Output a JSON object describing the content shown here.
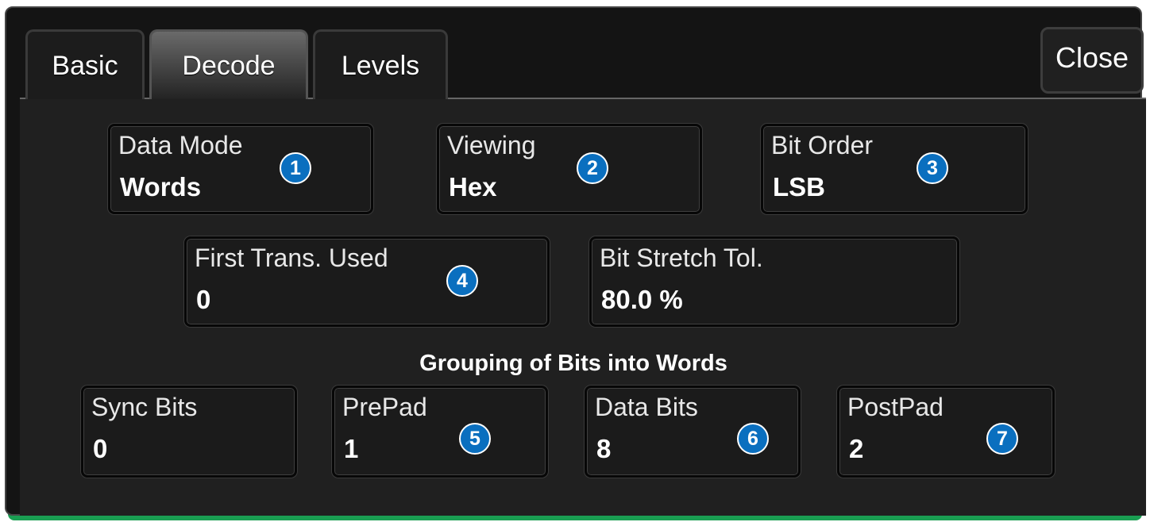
{
  "tabs": [
    {
      "label": "Basic",
      "active": false
    },
    {
      "label": "Decode",
      "active": true
    },
    {
      "label": "Levels",
      "active": false
    }
  ],
  "close_label": "Close",
  "fields": {
    "data_mode": {
      "label": "Data Mode",
      "value": "Words",
      "badge": "1"
    },
    "viewing": {
      "label": "Viewing",
      "value": "Hex",
      "badge": "2"
    },
    "bit_order": {
      "label": "Bit Order",
      "value": "LSB",
      "badge": "3"
    },
    "first_trans_used": {
      "label": "First Trans. Used",
      "value": "0",
      "badge": "4"
    },
    "bit_stretch_tol": {
      "label": "Bit Stretch Tol.",
      "value": "80.0 %"
    },
    "sync_bits": {
      "label": "Sync Bits",
      "value": "0"
    },
    "prepad": {
      "label": "PrePad",
      "value": "1",
      "badge": "5"
    },
    "data_bits": {
      "label": "Data Bits",
      "value": "8",
      "badge": "6"
    },
    "postpad": {
      "label": "PostPad",
      "value": "2",
      "badge": "7"
    }
  },
  "grouping_heading": "Grouping of Bits into Words",
  "colors": {
    "badge": "#0a6fbf",
    "background": "#141414",
    "accent_bottom": "#1a9e52"
  }
}
